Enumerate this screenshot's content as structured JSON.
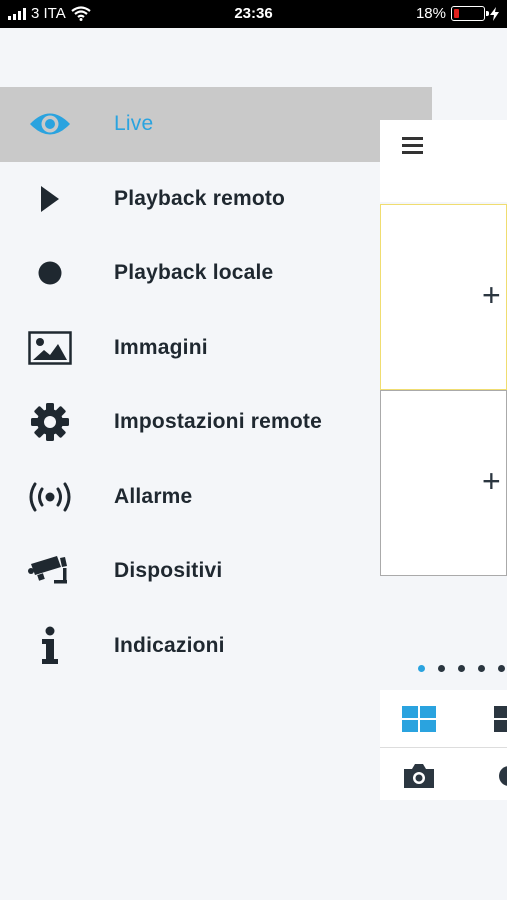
{
  "status_bar": {
    "carrier": "3 ITA",
    "time": "23:36",
    "battery_percent": "18%",
    "battery_level": 0.18,
    "battery_color": "#e0201c"
  },
  "menu": {
    "active_color": "#2aa3df",
    "items": [
      {
        "label": "Live",
        "icon": "eye-icon",
        "active": true
      },
      {
        "label": "Playback remoto",
        "icon": "play-icon",
        "active": false
      },
      {
        "label": "Playback locale",
        "icon": "record-dot-icon",
        "active": false
      },
      {
        "label": "Immagini",
        "icon": "image-icon",
        "active": false
      },
      {
        "label": "Impostazioni remote",
        "icon": "gear-icon",
        "active": false
      },
      {
        "label": "Allarme",
        "icon": "broadcast-icon",
        "active": false
      },
      {
        "label": "Dispositivi",
        "icon": "security-camera-icon",
        "active": false
      },
      {
        "label": "Indicazioni",
        "icon": "info-icon",
        "active": false
      }
    ]
  },
  "live_panel": {
    "cells": [
      {
        "action": "+"
      },
      {
        "action": "+"
      }
    ],
    "page_count": 5,
    "current_page": 1
  }
}
